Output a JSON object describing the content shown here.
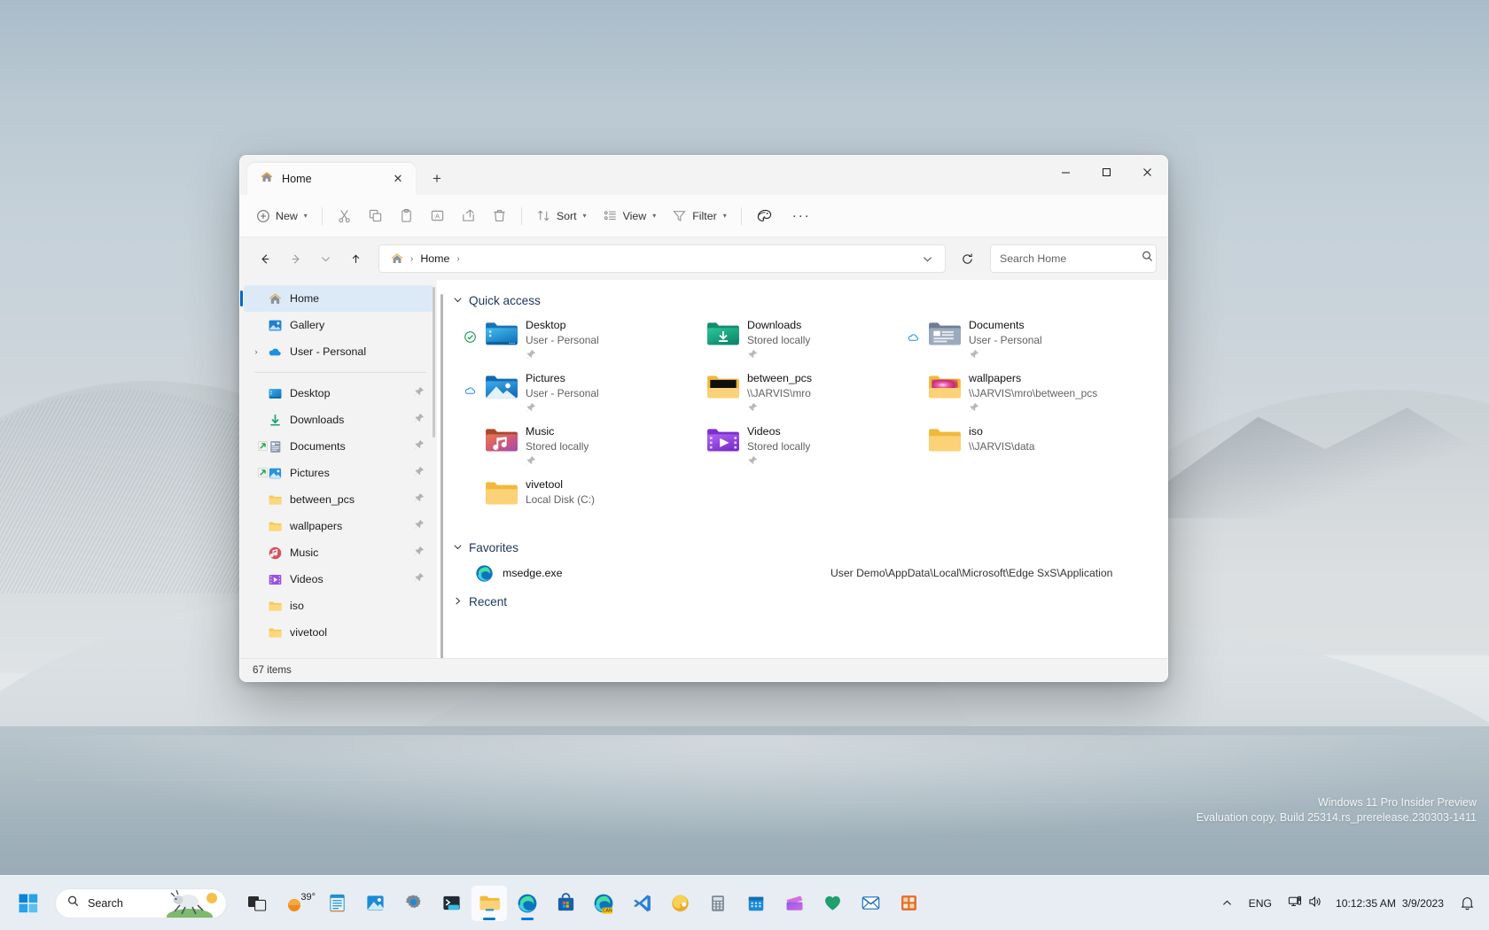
{
  "window": {
    "tab_title": "Home",
    "tab_close_label": "✕",
    "newtab_label": "+",
    "controls": {
      "minimize": "—",
      "maximize": "▢",
      "close": "✕"
    }
  },
  "toolbar": {
    "new_label": "New",
    "sort_label": "Sort",
    "view_label": "View",
    "filter_label": "Filter",
    "overflow_label": "···",
    "icons": [
      "cut-icon",
      "copy-icon",
      "paste-icon",
      "rename-icon",
      "share-icon",
      "delete-icon",
      "preview-pane-icon"
    ]
  },
  "address": {
    "home_crumb": "Home",
    "crumb_sep": "›",
    "dropdown": "⌄",
    "refresh": "⟳",
    "back": "←",
    "forward": "→",
    "recent": "⌄",
    "up": "↑"
  },
  "search": {
    "placeholder": "Search Home",
    "value": ""
  },
  "sidebar": {
    "top_items": [
      {
        "label": "Home",
        "icon": "home-icon",
        "selected": true,
        "expandable": false
      },
      {
        "label": "Gallery",
        "icon": "gallery-icon",
        "selected": false,
        "expandable": false
      },
      {
        "label": "User - Personal",
        "icon": "onedrive-icon",
        "selected": false,
        "expandable": true
      }
    ],
    "pinned_items": [
      {
        "label": "Desktop",
        "icon": "desktop-icon",
        "pinned": true,
        "shortcut": false
      },
      {
        "label": "Downloads",
        "icon": "downloads-icon",
        "pinned": true,
        "shortcut": false
      },
      {
        "label": "Documents",
        "icon": "documents-icon",
        "pinned": true,
        "shortcut": true
      },
      {
        "label": "Pictures",
        "icon": "pictures-icon",
        "pinned": true,
        "shortcut": true
      },
      {
        "label": "between_pcs",
        "icon": "folder-icon",
        "pinned": true,
        "shortcut": false
      },
      {
        "label": "wallpapers",
        "icon": "folder-icon",
        "pinned": true,
        "shortcut": false
      },
      {
        "label": "Music",
        "icon": "music-icon",
        "pinned": true,
        "shortcut": false
      },
      {
        "label": "Videos",
        "icon": "videos-icon",
        "pinned": true,
        "shortcut": false
      },
      {
        "label": "iso",
        "icon": "folder-icon",
        "pinned": false,
        "shortcut": false
      },
      {
        "label": "vivetool",
        "icon": "folder-icon",
        "pinned": false,
        "shortcut": false
      }
    ]
  },
  "content": {
    "quick_access": {
      "title": "Quick access",
      "chevron": "⌄",
      "items": [
        {
          "name": "Desktop",
          "sub": "User - Personal",
          "icon": "desktop-folder-icon",
          "status": "synced",
          "pinned": true
        },
        {
          "name": "Downloads",
          "sub": "Stored locally",
          "icon": "downloads-folder-icon",
          "status": "none",
          "pinned": true
        },
        {
          "name": "Documents",
          "sub": "User - Personal",
          "icon": "documents-folder-icon",
          "status": "cloud",
          "pinned": true
        },
        {
          "name": "Pictures",
          "sub": "User - Personal",
          "icon": "pictures-folder-icon",
          "status": "cloud",
          "pinned": true
        },
        {
          "name": "between_pcs",
          "sub": "\\\\JARVIS\\mro",
          "icon": "black-folder-icon",
          "status": "none",
          "pinned": true
        },
        {
          "name": "wallpapers",
          "sub": "\\\\JARVIS\\mro\\between_pcs",
          "icon": "wallpaper-folder-icon",
          "status": "none",
          "pinned": true
        },
        {
          "name": "Music",
          "sub": "Stored locally",
          "icon": "music-folder-icon",
          "status": "none",
          "pinned": true
        },
        {
          "name": "Videos",
          "sub": "Stored locally",
          "icon": "videos-folder-icon",
          "status": "none",
          "pinned": true
        },
        {
          "name": "iso",
          "sub": "\\\\JARVIS\\data",
          "icon": "folder-icon",
          "status": "none",
          "pinned": false
        },
        {
          "name": "vivetool",
          "sub": "Local Disk (C:)",
          "icon": "folder-icon",
          "status": "none",
          "pinned": false
        }
      ]
    },
    "favorites": {
      "title": "Favorites",
      "chevron": "⌄",
      "items": [
        {
          "name": "msedge.exe",
          "path": "User Demo\\AppData\\Local\\Microsoft\\Edge SxS\\Application",
          "icon": "edge-icon"
        }
      ]
    },
    "recent": {
      "title": "Recent",
      "chevron": "›"
    }
  },
  "statusbar": {
    "item_count": "67 items"
  },
  "watermark": {
    "line1": "Windows 11 Pro Insider Preview",
    "line2": "Evaluation copy. Build 25314.rs_prerelease.230303-1411"
  },
  "taskbar": {
    "start_label": "start-icon",
    "search_placeholder": "Search",
    "weather_temp": "39°",
    "apps": [
      {
        "name": "task-view-icon"
      },
      {
        "name": "weather-widget"
      },
      {
        "name": "notepad-icon"
      },
      {
        "name": "photos-icon"
      },
      {
        "name": "settings-icon"
      },
      {
        "name": "terminal-icon"
      },
      {
        "name": "file-explorer-icon",
        "active": true,
        "running": true
      },
      {
        "name": "edge-icon",
        "running": true
      },
      {
        "name": "microsoft-store-icon"
      },
      {
        "name": "edge-canary-icon"
      },
      {
        "name": "vs-code-icon"
      },
      {
        "name": "firefox-icon"
      },
      {
        "name": "calculator-icon"
      },
      {
        "name": "calendar-icon"
      },
      {
        "name": "clipchamp-icon"
      },
      {
        "name": "health-icon"
      },
      {
        "name": "mail-icon"
      },
      {
        "name": "store-app-icon"
      }
    ],
    "tray": {
      "chevron": "⌃",
      "language": "ENG",
      "network_icon": "network-icon",
      "volume_icon": "volume-icon",
      "time": "10:12:35 AM",
      "date": "3/9/2023",
      "notifications_icon": "notification-bell-icon"
    }
  }
}
